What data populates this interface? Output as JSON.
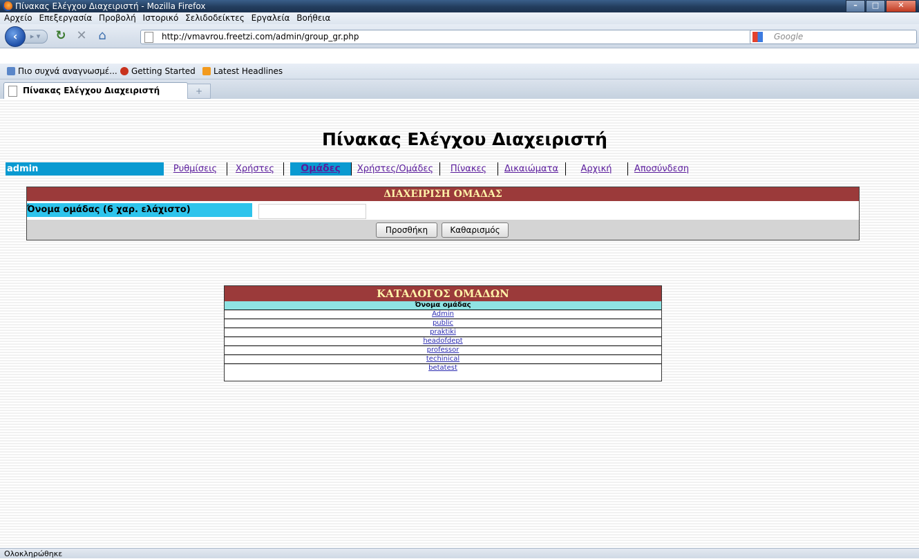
{
  "window": {
    "title": "Πίνακας Ελέγχου Διαχειριστή - Mozilla Firefox"
  },
  "menubar": [
    "Αρχείο",
    "Επεξεργασία",
    "Προβολή",
    "Ιστορικό",
    "Σελιδοδείκτες",
    "Εργαλεία",
    "Βοήθεια"
  ],
  "navbar": {
    "url": "http://vmavrou.freetzi.com/admin/group_gr.php",
    "search_placeholder": "Google"
  },
  "bookmarks": [
    "Πιο συχνά αναγνωσμέ...",
    "Getting Started",
    "Latest Headlines"
  ],
  "tab": {
    "title": "Πίνακας Ελέγχου Διαχειριστή",
    "newtab_symbol": "+"
  },
  "page": {
    "title": "Πίνακας Ελέγχου Διαχειριστή",
    "user": "admin",
    "nav": [
      "Ρυθμίσεις",
      "Χρήστες",
      "Ομάδες",
      "Χρήστες/Ομάδες",
      "Πίνακες",
      "Δικαιώματα",
      "Αρχική",
      "Αποσύνδεση"
    ],
    "active_nav": "Ομάδες"
  },
  "group_form": {
    "header": "ΔΙΑΧΕΙΡΙΣΗ ΟΜΑΔΑΣ",
    "label": "Όνομα ομάδας (6 χαρ. ελάχιστο)",
    "input_value": "",
    "add_button": "Προσθήκη",
    "clear_button": "Καθαρισμός"
  },
  "groups_list": {
    "header": "ΚΑΤΑΛΟΓΟΣ ΟΜΑΔΩΝ",
    "column": "Όνομα ομάδας",
    "rows": [
      "Admin",
      "public",
      "praktiki",
      "headofdept",
      "professor",
      "techinical",
      "betatest"
    ]
  },
  "status": "Ολοκληρώθηκε",
  "colors": {
    "header_bg": "#9b3a3a",
    "header_text": "#fff2a8",
    "accent_blue": "#0a9ad1",
    "label_cyan": "#2ec4ec",
    "column_head": "#8fe3e3"
  }
}
